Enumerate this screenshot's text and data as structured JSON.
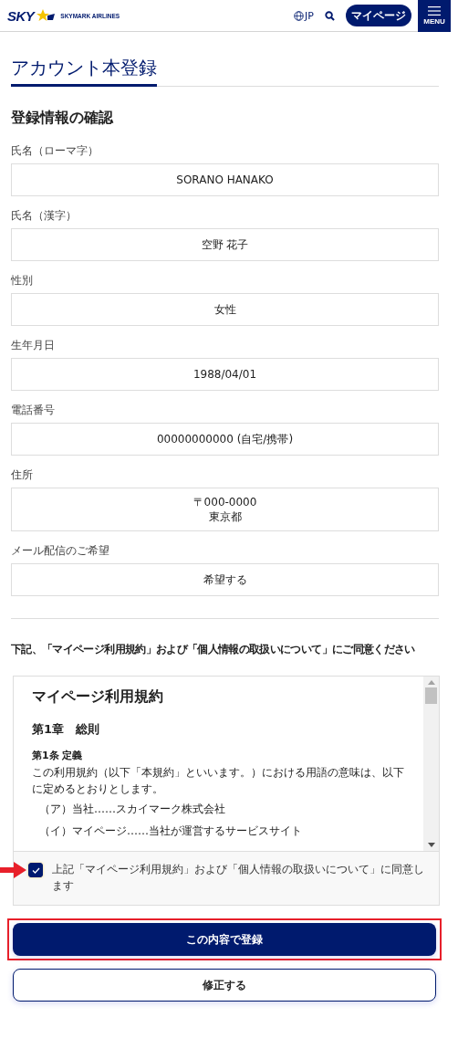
{
  "header": {
    "logo_mark": "SKY",
    "logo_name": "SKYMARK AIRLINES",
    "language": "JP",
    "mypage_button": "マイページ",
    "menu_label": "MENU"
  },
  "page_title": "アカウント本登録",
  "section_title": "登録情報の確認",
  "fields": [
    {
      "label": "氏名（ローマ字）",
      "lines": [
        "SORANO HANAKO"
      ]
    },
    {
      "label": "氏名（漢字）",
      "lines": [
        "空野 花子"
      ]
    },
    {
      "label": "性別",
      "lines": [
        "女性"
      ]
    },
    {
      "label": "生年月日",
      "lines": [
        "1988/04/01"
      ]
    },
    {
      "label": "電話番号",
      "lines": [
        "00000000000 (自宅/携帯)"
      ]
    },
    {
      "label": "住所",
      "lines": [
        "〒000-0000",
        "東京都"
      ]
    },
    {
      "label": "メール配信のご希望",
      "lines": [
        "希望する"
      ]
    }
  ],
  "agreement_prompt": "下記、「マイページ利用規約」および「個人情報の取扱いについて」にご同意ください",
  "terms": {
    "title": "マイページ利用規約",
    "chapter": "第1章　総則",
    "article": "第1条 定義",
    "paragraph": "この利用規約（以下「本規約」といいます。）における用語の意味は、以下に定めるとおりとします。",
    "items": [
      "（ア）当社……スカイマーク株式会社",
      "（イ）マイページ……当社が運営するサービスサイト"
    ]
  },
  "consent": {
    "label": "上記「マイページ利用規約」および「個人情報の取扱いについて」に同意します",
    "checked": true
  },
  "buttons": [
    {
      "kind": "primary",
      "label": "この内容で登録",
      "highlighted": true
    },
    {
      "kind": "secondary",
      "label": "修正する",
      "highlighted": false
    }
  ]
}
